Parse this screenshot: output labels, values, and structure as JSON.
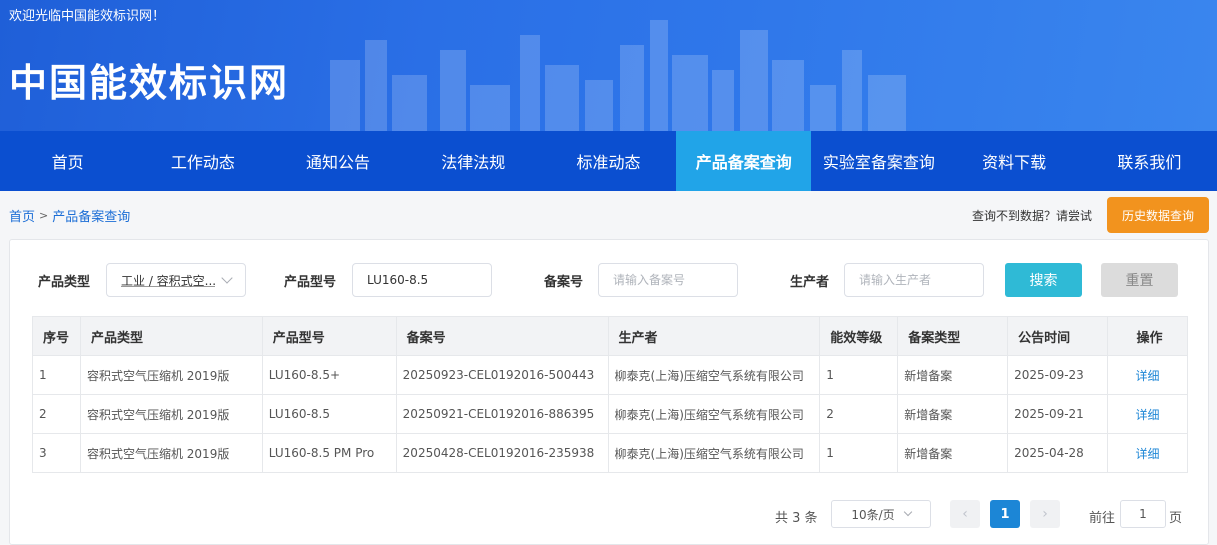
{
  "header": {
    "welcome": "欢迎光临中国能效标识网！",
    "site_title": "中国能效标识网"
  },
  "nav": {
    "items": [
      "首页",
      "工作动态",
      "通知公告",
      "法律法规",
      "标准动态",
      "产品备案查询",
      "实验室备案查询",
      "资料下载",
      "联系我们"
    ],
    "active": "产品备案查询"
  },
  "breadcrumb": {
    "home": "首页",
    "separator": ">",
    "current": "产品备案查询"
  },
  "hint": "查询不到数据？请尝试",
  "history_button": "历史数据查询",
  "filters": {
    "product_type_label": "产品类型",
    "product_type_value": "工业 / 容积式空...",
    "model_label": "产品型号",
    "model_value": "LU160-8.5",
    "record_no_label": "备案号",
    "record_no_placeholder": "请输入备案号",
    "producer_label": "生产者",
    "producer_placeholder": "请输入生产者",
    "search_button": "搜索",
    "reset_button": "重置"
  },
  "table": {
    "headers": [
      "序号",
      "产品类型",
      "产品型号",
      "备案号",
      "生产者",
      "能效等级",
      "备案类型",
      "公告时间",
      "操作"
    ],
    "rows": [
      [
        "1",
        "容积式空气压缩机 2019版",
        "LU160-8.5+",
        "20250923-CEL0192016-500443",
        "柳泰克(上海)压缩空气系统有限公司",
        "1",
        "新增备案",
        "2025-09-23",
        "详细"
      ],
      [
        "2",
        "容积式空气压缩机 2019版",
        "LU160-8.5",
        "20250921-CEL0192016-886395",
        "柳泰克(上海)压缩空气系统有限公司",
        "2",
        "新增备案",
        "2025-09-21",
        "详细"
      ],
      [
        "3",
        "容积式空气压缩机 2019版",
        "LU160-8.5 PM Pro",
        "20250428-CEL0192016-235938",
        "柳泰克(上海)压缩空气系统有限公司",
        "1",
        "新增备案",
        "2025-04-28",
        "详细"
      ]
    ]
  },
  "pagination": {
    "total": "共 3 条",
    "page_size": "10条/页",
    "prev": "‹",
    "current_page": "1",
    "next": "›",
    "goto_prefix": "前往",
    "goto_value": "1",
    "goto_suffix": "页"
  },
  "colors": {
    "nav_bg": "#0b4fd0",
    "nav_active": "#21a4e8",
    "history_button": "#f2931e",
    "search_button": "#2fbad6",
    "link": "#1c86d6"
  }
}
